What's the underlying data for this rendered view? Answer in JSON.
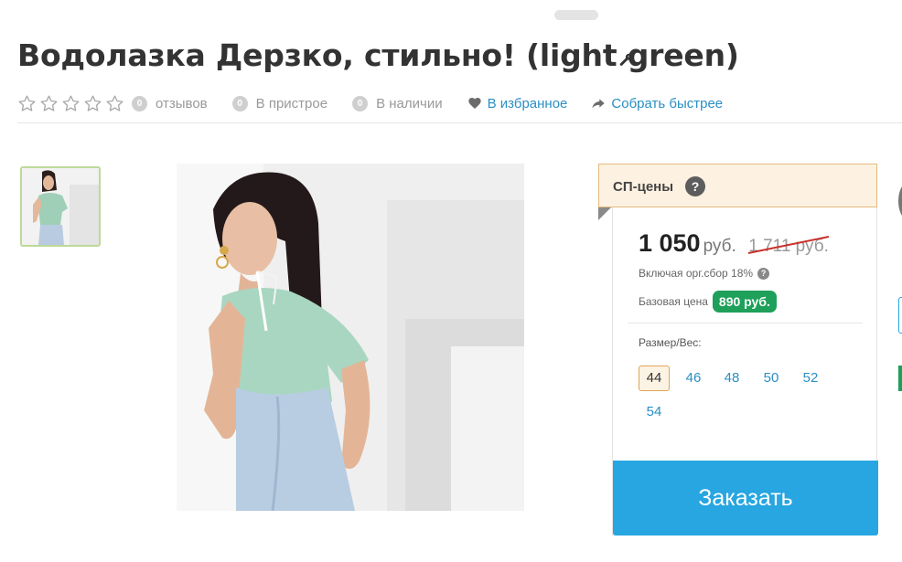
{
  "product": {
    "title": "Водолазка Дерзко, стильно! (light green)"
  },
  "meta": {
    "reviews_count": "0",
    "reviews_label": "отзывов",
    "attached_count": "0",
    "attached_label": "В пристрое",
    "stock_count": "0",
    "stock_label": "В наличии",
    "favorite_label": "В избранное",
    "collect_label": "Собрать быстрее",
    "rating": 0,
    "rating_max": 5
  },
  "sp_box": {
    "label": "СП-цены",
    "help": "?"
  },
  "pricing": {
    "price": "1 050",
    "currency": "руб.",
    "old_price": "1 711 руб.",
    "including_note": "Включая орг.сбор 18%",
    "help": "?",
    "base_label": "Базовая цена",
    "base_price": "890 руб."
  },
  "size": {
    "label": "Размер/Вес:",
    "options": [
      "44",
      "46",
      "48",
      "50",
      "52",
      "54"
    ],
    "selected": "44"
  },
  "order_button": "Заказать",
  "colors": {
    "accent": "#27a6e1",
    "link": "#2a8fc4",
    "green_badge": "#1ea05a",
    "sp_bg": "#fdf1e1"
  }
}
